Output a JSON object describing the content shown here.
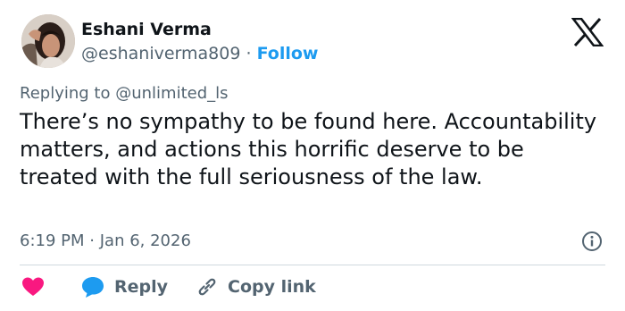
{
  "author": {
    "name": "Eshani Verma",
    "handle": "@eshaniverma809",
    "separator": "·",
    "follow_label": "Follow"
  },
  "reply_context": {
    "prefix": "Replying to",
    "mention": "@unlimited_ls"
  },
  "tweet": {
    "text": "There’s no sympathy to be found here. Accountability matters, and actions this horrific deserve to be treated with the full seriousness of the law.",
    "time": "6:19 PM",
    "date_separator": "·",
    "date": "Jan 6, 2026"
  },
  "actions": {
    "reply_label": "Reply",
    "copy_link_label": "Copy link"
  },
  "colors": {
    "accent": "#1d9bf0",
    "heart": "#f91880",
    "secondary_text": "#536471",
    "primary_text": "#0f1419",
    "divider": "#cfd9de"
  },
  "icons": [
    "x-logo-icon",
    "info-icon",
    "heart-icon",
    "reply-bubble-icon",
    "link-icon"
  ]
}
